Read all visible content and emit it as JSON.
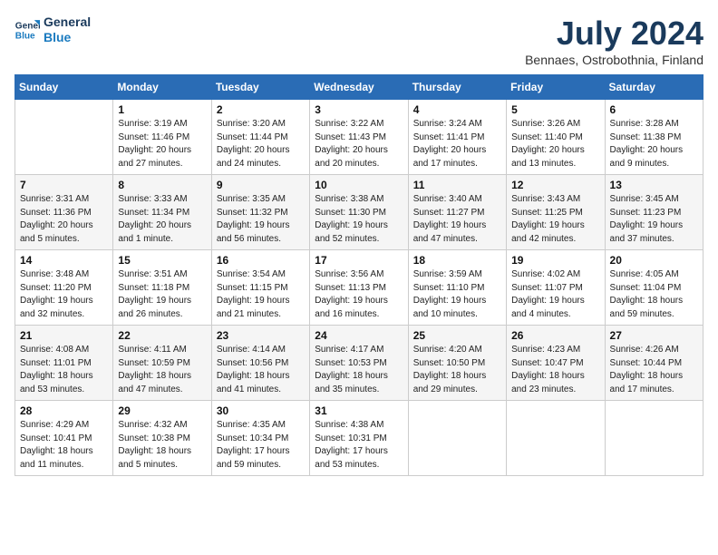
{
  "logo": {
    "line1": "General",
    "line2": "Blue"
  },
  "title": "July 2024",
  "location": "Bennaes, Ostrobothnia, Finland",
  "days_header": [
    "Sunday",
    "Monday",
    "Tuesday",
    "Wednesday",
    "Thursday",
    "Friday",
    "Saturday"
  ],
  "weeks": [
    [
      {
        "day": "",
        "info": ""
      },
      {
        "day": "1",
        "info": "Sunrise: 3:19 AM\nSunset: 11:46 PM\nDaylight: 20 hours\nand 27 minutes."
      },
      {
        "day": "2",
        "info": "Sunrise: 3:20 AM\nSunset: 11:44 PM\nDaylight: 20 hours\nand 24 minutes."
      },
      {
        "day": "3",
        "info": "Sunrise: 3:22 AM\nSunset: 11:43 PM\nDaylight: 20 hours\nand 20 minutes."
      },
      {
        "day": "4",
        "info": "Sunrise: 3:24 AM\nSunset: 11:41 PM\nDaylight: 20 hours\nand 17 minutes."
      },
      {
        "day": "5",
        "info": "Sunrise: 3:26 AM\nSunset: 11:40 PM\nDaylight: 20 hours\nand 13 minutes."
      },
      {
        "day": "6",
        "info": "Sunrise: 3:28 AM\nSunset: 11:38 PM\nDaylight: 20 hours\nand 9 minutes."
      }
    ],
    [
      {
        "day": "7",
        "info": "Sunrise: 3:31 AM\nSunset: 11:36 PM\nDaylight: 20 hours\nand 5 minutes."
      },
      {
        "day": "8",
        "info": "Sunrise: 3:33 AM\nSunset: 11:34 PM\nDaylight: 20 hours\nand 1 minute."
      },
      {
        "day": "9",
        "info": "Sunrise: 3:35 AM\nSunset: 11:32 PM\nDaylight: 19 hours\nand 56 minutes."
      },
      {
        "day": "10",
        "info": "Sunrise: 3:38 AM\nSunset: 11:30 PM\nDaylight: 19 hours\nand 52 minutes."
      },
      {
        "day": "11",
        "info": "Sunrise: 3:40 AM\nSunset: 11:27 PM\nDaylight: 19 hours\nand 47 minutes."
      },
      {
        "day": "12",
        "info": "Sunrise: 3:43 AM\nSunset: 11:25 PM\nDaylight: 19 hours\nand 42 minutes."
      },
      {
        "day": "13",
        "info": "Sunrise: 3:45 AM\nSunset: 11:23 PM\nDaylight: 19 hours\nand 37 minutes."
      }
    ],
    [
      {
        "day": "14",
        "info": "Sunrise: 3:48 AM\nSunset: 11:20 PM\nDaylight: 19 hours\nand 32 minutes."
      },
      {
        "day": "15",
        "info": "Sunrise: 3:51 AM\nSunset: 11:18 PM\nDaylight: 19 hours\nand 26 minutes."
      },
      {
        "day": "16",
        "info": "Sunrise: 3:54 AM\nSunset: 11:15 PM\nDaylight: 19 hours\nand 21 minutes."
      },
      {
        "day": "17",
        "info": "Sunrise: 3:56 AM\nSunset: 11:13 PM\nDaylight: 19 hours\nand 16 minutes."
      },
      {
        "day": "18",
        "info": "Sunrise: 3:59 AM\nSunset: 11:10 PM\nDaylight: 19 hours\nand 10 minutes."
      },
      {
        "day": "19",
        "info": "Sunrise: 4:02 AM\nSunset: 11:07 PM\nDaylight: 19 hours\nand 4 minutes."
      },
      {
        "day": "20",
        "info": "Sunrise: 4:05 AM\nSunset: 11:04 PM\nDaylight: 18 hours\nand 59 minutes."
      }
    ],
    [
      {
        "day": "21",
        "info": "Sunrise: 4:08 AM\nSunset: 11:01 PM\nDaylight: 18 hours\nand 53 minutes."
      },
      {
        "day": "22",
        "info": "Sunrise: 4:11 AM\nSunset: 10:59 PM\nDaylight: 18 hours\nand 47 minutes."
      },
      {
        "day": "23",
        "info": "Sunrise: 4:14 AM\nSunset: 10:56 PM\nDaylight: 18 hours\nand 41 minutes."
      },
      {
        "day": "24",
        "info": "Sunrise: 4:17 AM\nSunset: 10:53 PM\nDaylight: 18 hours\nand 35 minutes."
      },
      {
        "day": "25",
        "info": "Sunrise: 4:20 AM\nSunset: 10:50 PM\nDaylight: 18 hours\nand 29 minutes."
      },
      {
        "day": "26",
        "info": "Sunrise: 4:23 AM\nSunset: 10:47 PM\nDaylight: 18 hours\nand 23 minutes."
      },
      {
        "day": "27",
        "info": "Sunrise: 4:26 AM\nSunset: 10:44 PM\nDaylight: 18 hours\nand 17 minutes."
      }
    ],
    [
      {
        "day": "28",
        "info": "Sunrise: 4:29 AM\nSunset: 10:41 PM\nDaylight: 18 hours\nand 11 minutes."
      },
      {
        "day": "29",
        "info": "Sunrise: 4:32 AM\nSunset: 10:38 PM\nDaylight: 18 hours\nand 5 minutes."
      },
      {
        "day": "30",
        "info": "Sunrise: 4:35 AM\nSunset: 10:34 PM\nDaylight: 17 hours\nand 59 minutes."
      },
      {
        "day": "31",
        "info": "Sunrise: 4:38 AM\nSunset: 10:31 PM\nDaylight: 17 hours\nand 53 minutes."
      },
      {
        "day": "",
        "info": ""
      },
      {
        "day": "",
        "info": ""
      },
      {
        "day": "",
        "info": ""
      }
    ]
  ]
}
